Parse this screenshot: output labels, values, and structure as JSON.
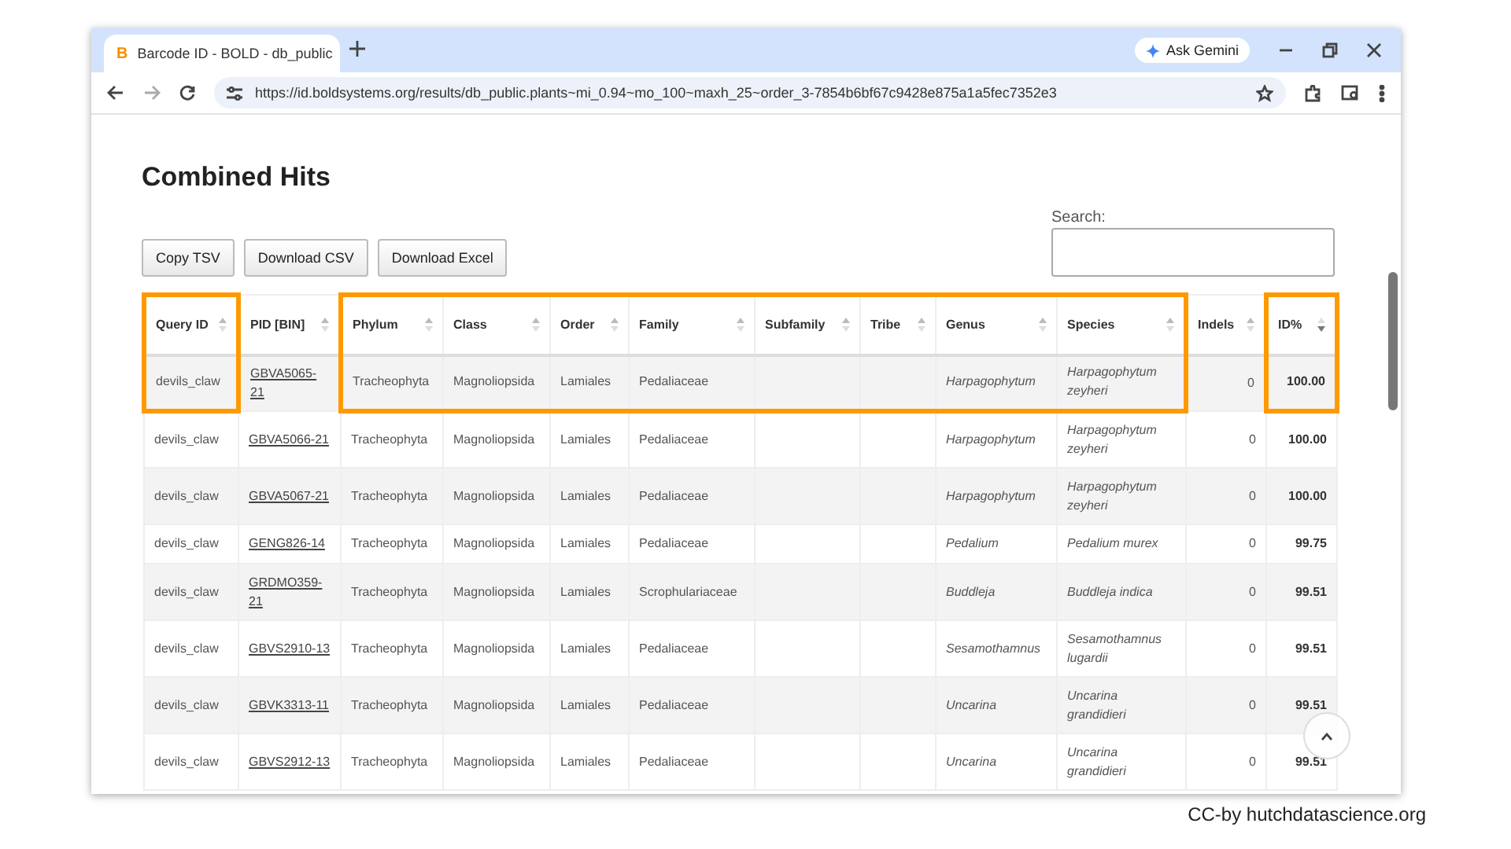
{
  "browser": {
    "favicon": "B",
    "tab_title": "Barcode ID - BOLD - db_public",
    "url": "https://id.boldsystems.org/results/db_public.plants~mi_0.94~mo_100~maxh_25~order_3-7854b6bf67c9428e875a1a5fec7352e3",
    "ask_button": "Ask Gemini"
  },
  "page": {
    "heading": "Combined Hits",
    "buttons": [
      "Copy TSV",
      "Download CSV",
      "Download Excel"
    ],
    "search": {
      "label": "Search:"
    }
  },
  "table": {
    "columns": [
      {
        "label": "Query ID",
        "kind": "text",
        "highlighted": true,
        "sorted": false
      },
      {
        "label": "PID [BIN]",
        "kind": "link",
        "highlighted": false,
        "sorted": false
      },
      {
        "label": "Phylum",
        "kind": "text",
        "highlighted": true,
        "sorted": false
      },
      {
        "label": "Class",
        "kind": "text",
        "highlighted": true,
        "sorted": false
      },
      {
        "label": "Order",
        "kind": "text",
        "highlighted": true,
        "sorted": false
      },
      {
        "label": "Family",
        "kind": "text",
        "highlighted": true,
        "sorted": false
      },
      {
        "label": "Subfamily",
        "kind": "text",
        "highlighted": true,
        "sorted": false
      },
      {
        "label": "Tribe",
        "kind": "text",
        "highlighted": true,
        "sorted": false
      },
      {
        "label": "Genus",
        "kind": "taxon",
        "highlighted": true,
        "sorted": false
      },
      {
        "label": "Species",
        "kind": "taxon",
        "highlighted": true,
        "sorted": false
      },
      {
        "label": "Indels",
        "kind": "count",
        "highlighted": false,
        "sorted": false
      },
      {
        "label": "ID%",
        "kind": "score",
        "highlighted": true,
        "sorted": true
      }
    ],
    "rows": [
      [
        "devils_claw",
        "GBVA5065-21",
        "Tracheophyta",
        "Magnoliopsida",
        "Lamiales",
        "Pedaliaceae",
        null,
        null,
        "Harpagophytum",
        "Harpagophytum zeyheri",
        "0",
        "100.00"
      ],
      [
        "devils_claw",
        "GBVA5066-21",
        "Tracheophyta",
        "Magnoliopsida",
        "Lamiales",
        "Pedaliaceae",
        null,
        null,
        "Harpagophytum",
        "Harpagophytum zeyheri",
        "0",
        "100.00"
      ],
      [
        "devils_claw",
        "GBVA5067-21",
        "Tracheophyta",
        "Magnoliopsida",
        "Lamiales",
        "Pedaliaceae",
        null,
        null,
        "Harpagophytum",
        "Harpagophytum zeyheri",
        "0",
        "100.00"
      ],
      [
        "devils_claw",
        "GENG826-14",
        "Tracheophyta",
        "Magnoliopsida",
        "Lamiales",
        "Pedaliaceae",
        null,
        null,
        "Pedalium",
        "Pedalium murex",
        "0",
        "99.75"
      ],
      [
        "devils_claw",
        "GRDMO359-21",
        "Tracheophyta",
        "Magnoliopsida",
        "Lamiales",
        "Scrophulariaceae",
        null,
        null,
        "Buddleja",
        "Buddleja indica",
        "0",
        "99.51"
      ],
      [
        "devils_claw",
        "GBVS2910-13",
        "Tracheophyta",
        "Magnoliopsida",
        "Lamiales",
        "Pedaliaceae",
        null,
        null,
        "Sesamothamnus",
        "Sesamothamnus lugardii",
        "0",
        "99.51"
      ],
      [
        "devils_claw",
        "GBVK3313-11",
        "Tracheophyta",
        "Magnoliopsida",
        "Lamiales",
        "Pedaliaceae",
        null,
        null,
        "Uncarina",
        "Uncarina grandidieri",
        "0",
        "99.51"
      ],
      [
        "devils_claw",
        "GBVS2912-13",
        "Tracheophyta",
        "Magnoliopsida",
        "Lamiales",
        "Pedaliaceae",
        null,
        null,
        "Uncarina",
        "Uncarina grandidieri",
        "0",
        "99.51"
      ]
    ]
  },
  "caption": "CC-by hutchdatascience.org"
}
